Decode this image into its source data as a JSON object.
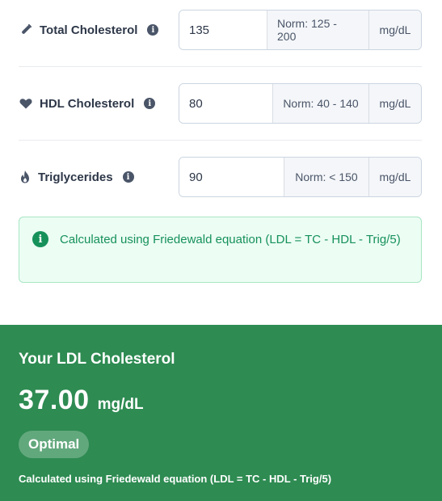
{
  "fields": [
    {
      "label": "Total Cholesterol",
      "icon": "test-tube-icon",
      "value": "135",
      "norm": "Norm: 125 - 200",
      "unit": "mg/dL"
    },
    {
      "label": "HDL Cholesterol",
      "icon": "heart-icon",
      "value": "80",
      "norm": "Norm: 40 - 140",
      "unit": "mg/dL"
    },
    {
      "label": "Triglycerides",
      "icon": "flame-icon",
      "value": "90",
      "norm": "Norm: < 150",
      "unit": "mg/dL"
    }
  ],
  "info_alert": {
    "text": "Calculated using Friedewald equation (LDL = TC - HDL - Trig/5)"
  },
  "result": {
    "title": "Your LDL Cholesterol",
    "value": "37.00",
    "unit": "mg/dL",
    "status": "Optimal",
    "note": "Calculated using Friedewald equation (LDL = TC - HDL - Trig/5)"
  },
  "colors": {
    "result_bg": "#2e8b52",
    "alert_bg": "#ecfdf4",
    "alert_text": "#16915a"
  }
}
